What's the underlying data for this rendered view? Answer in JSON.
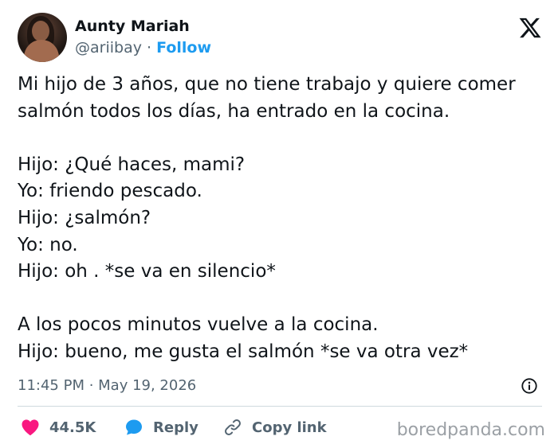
{
  "author": {
    "name": "Aunty Mariah",
    "handle": "@ariibay",
    "separator": "·",
    "follow_label": "Follow"
  },
  "tweet": {
    "lines": [
      "Mi hijo de 3 años, que no tiene trabajo y quiere comer",
      "salmón todos los días, ha entrado en la cocina.",
      "",
      "Hijo: ¿Qué haces, mami?",
      "Yo: friendo pescado.",
      "Hijo: ¿salmón?",
      "Yo: no.",
      "Hijo: oh . *se va en silencio*",
      "",
      "A los pocos minutos vuelve a la cocina.",
      "Hijo: bueno, me gusta el salmón *se va otra vez*"
    ]
  },
  "meta": {
    "timestamp": "11:45 PM · May 19, 2026"
  },
  "actions": {
    "likes": "44.5K",
    "reply_label": "Reply",
    "copy_link_label": "Copy link"
  },
  "colors": {
    "accent": "#1d9bf0",
    "like": "#f91880",
    "muted": "#536471",
    "text": "#0f1419"
  },
  "icons": {
    "platform": "x-logo-icon",
    "like": "heart-icon",
    "reply": "speech-bubble-icon",
    "copy": "link-icon",
    "info": "info-icon"
  },
  "watermark": "boredpanda.com"
}
